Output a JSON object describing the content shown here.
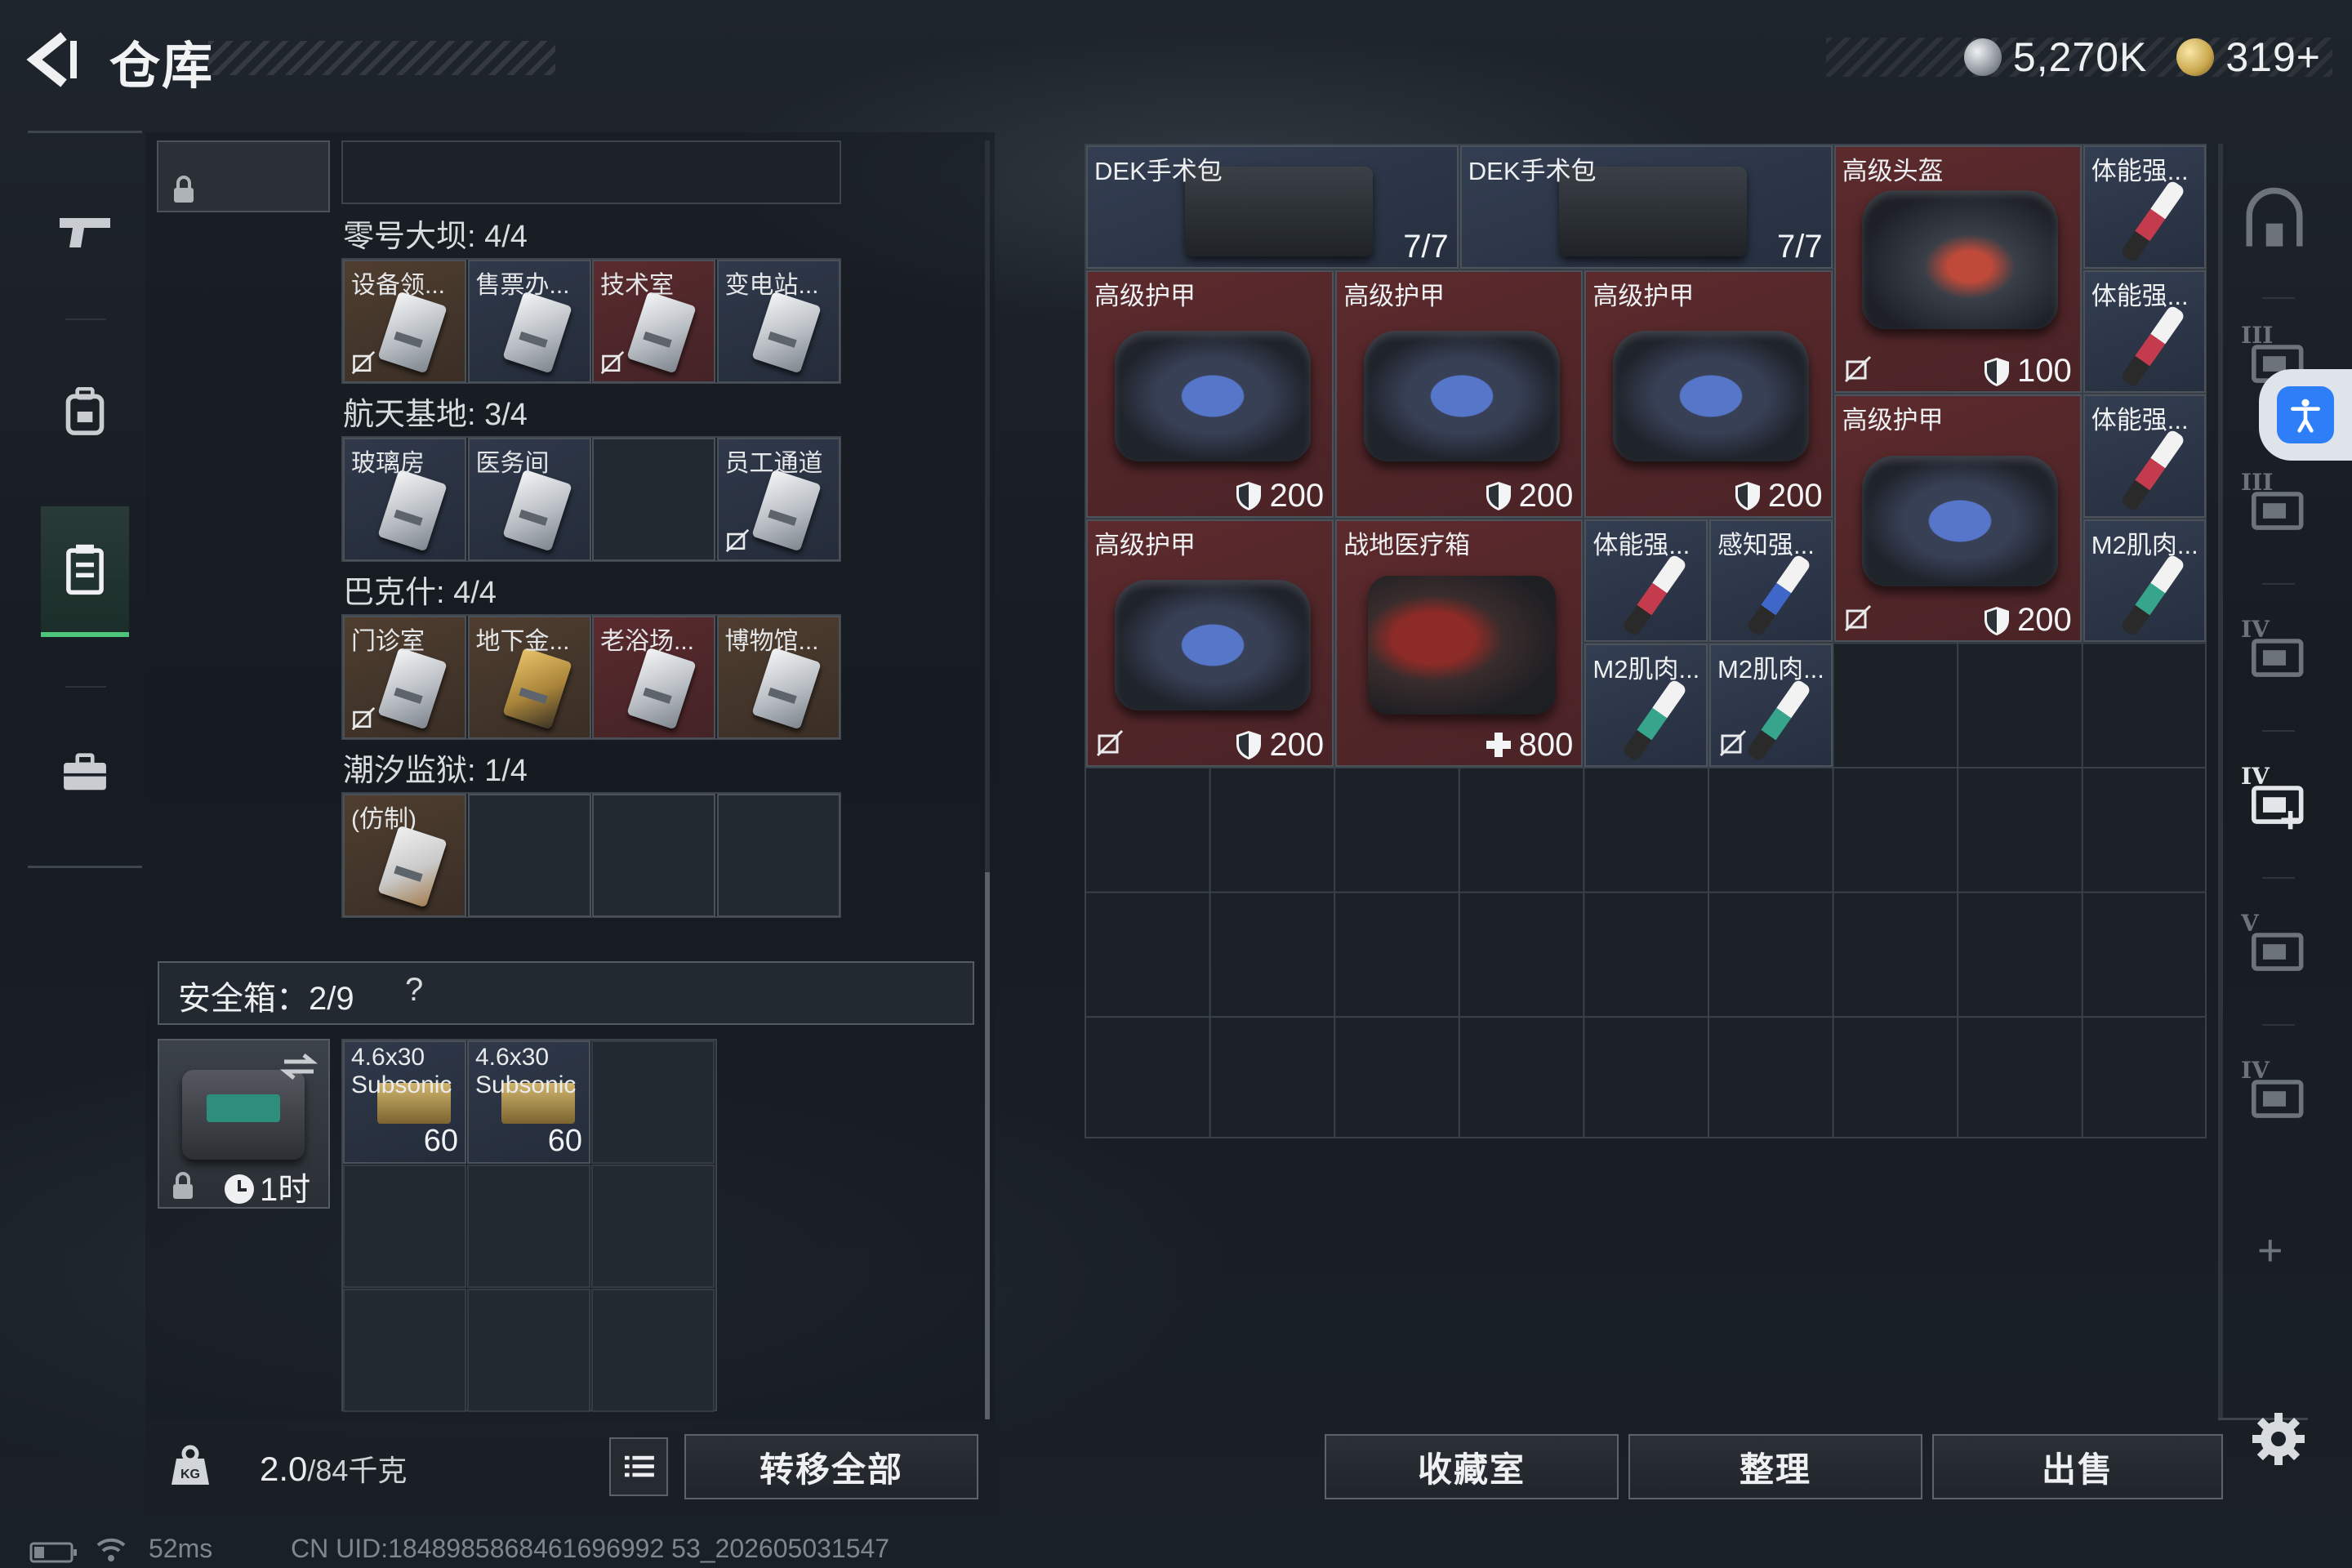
{
  "header": {
    "title": "仓库",
    "currency": [
      {
        "icon": "silver-coin-icon",
        "value": "5,270K"
      },
      {
        "icon": "gold-coin-icon",
        "value": "319+"
      }
    ]
  },
  "left_sidebar": {
    "items": [
      {
        "name": "weapons",
        "icon": "pistol-icon"
      },
      {
        "name": "backpack",
        "icon": "backpack-icon"
      },
      {
        "name": "keys",
        "icon": "keycard-holder-icon",
        "active": true
      },
      {
        "name": "gear",
        "icon": "briefcase-icon"
      }
    ]
  },
  "key_sections": [
    {
      "label": "零号大坝: 4/4",
      "cards": [
        {
          "name": "设备领...",
          "style": "brown",
          "no_drop": true
        },
        {
          "name": "售票办...",
          "style": "blue",
          "no_drop": false
        },
        {
          "name": "技术室",
          "style": "red",
          "no_drop": true
        },
        {
          "name": "变电站...",
          "style": "blue",
          "no_drop": false
        }
      ]
    },
    {
      "label": "航天基地: 3/4",
      "cards": [
        {
          "name": "玻璃房",
          "style": "blue",
          "no_drop": false
        },
        {
          "name": "医务间",
          "style": "blue",
          "no_drop": false
        },
        null,
        {
          "name": "员工通道",
          "style": "blue",
          "no_drop": true
        }
      ]
    },
    {
      "label": "巴克什: 4/4",
      "cards": [
        {
          "name": "门诊室",
          "style": "brown",
          "no_drop": true
        },
        {
          "name": "地下金...",
          "style": "brown",
          "no_drop": false,
          "gold": true
        },
        {
          "name": "老浴场...",
          "style": "red",
          "no_drop": false
        },
        {
          "name": "博物馆...",
          "style": "brown",
          "no_drop": false
        }
      ]
    },
    {
      "label": "潮汐监狱: 1/4",
      "cards": [
        {
          "name": "(仿制)",
          "style": "brown",
          "no_drop": false,
          "fake": true
        },
        null,
        null,
        null
      ]
    }
  ],
  "safe_case": {
    "label": "安全箱：2/9",
    "help": "?",
    "timer": "1时",
    "ammo": [
      {
        "name": "4.6x30\nSubsonic",
        "count": "60"
      },
      {
        "name": "4.6x30\nSubsonic",
        "count": "60"
      }
    ]
  },
  "bottom_left": {
    "weight_current": "2.0",
    "weight_capacity": "/84千克",
    "transfer_all": "转移全部"
  },
  "storage": {
    "items": [
      {
        "name": "DEK手术包",
        "value": "7/7",
        "bg": "blue",
        "icon": "surgical-kit",
        "value_icon": "none"
      },
      {
        "name": "DEK手术包",
        "value": "7/7",
        "bg": "blue",
        "icon": "surgical-kit",
        "value_icon": "none"
      },
      {
        "name": "高级头盔",
        "value": "100",
        "bg": "red",
        "icon": "helmet",
        "value_icon": "shield",
        "no_drop": true
      },
      {
        "name": "体能强...",
        "value": "",
        "bg": "blue",
        "icon": "syringe-red"
      },
      {
        "name": "高级护甲",
        "value": "200",
        "bg": "red",
        "icon": "vest",
        "value_icon": "shield"
      },
      {
        "name": "高级护甲",
        "value": "200",
        "bg": "red",
        "icon": "vest",
        "value_icon": "shield"
      },
      {
        "name": "高级护甲",
        "value": "200",
        "bg": "red",
        "icon": "vest",
        "value_icon": "shield"
      },
      {
        "name": "体能强...",
        "value": "",
        "bg": "blue",
        "icon": "syringe-red"
      },
      {
        "name": "高级护甲",
        "value": "200",
        "bg": "red",
        "icon": "vest",
        "value_icon": "shield",
        "no_drop": true
      },
      {
        "name": "体能强...",
        "value": "",
        "bg": "blue",
        "icon": "syringe-red"
      },
      {
        "name": "高级护甲",
        "value": "200",
        "bg": "red",
        "icon": "vest",
        "value_icon": "shield",
        "no_drop": true
      },
      {
        "name": "战地医疗箱",
        "value": "800",
        "bg": "red",
        "icon": "medbox",
        "value_icon": "plus"
      },
      {
        "name": "体能强...",
        "value": "",
        "bg": "blue",
        "icon": "syringe-red"
      },
      {
        "name": "感知强...",
        "value": "",
        "bg": "blue",
        "icon": "syringe-blue"
      },
      {
        "name": "M2肌肉...",
        "value": "",
        "bg": "blue",
        "icon": "syringe-green"
      },
      {
        "name": "M2肌肉...",
        "value": "",
        "bg": "blue",
        "icon": "syringe-green"
      },
      {
        "name": "M2肌肉...",
        "value": "",
        "bg": "blue",
        "icon": "syringe-green",
        "no_drop": true
      }
    ]
  },
  "bottom_buttons": {
    "collection": "收藏室",
    "sort": "整理",
    "sell": "出售"
  },
  "right_sidebar": {
    "tabs": [
      {
        "icon": "storage-arch-icon",
        "level": ""
      },
      {
        "icon": "storage-tier-icon",
        "level": "III"
      },
      {
        "icon": "storage-tier-icon",
        "level": "III"
      },
      {
        "icon": "storage-tier-icon",
        "level": "IV"
      },
      {
        "icon": "storage-add-icon",
        "level": "IV"
      },
      {
        "icon": "storage-tier-icon",
        "level": "V"
      },
      {
        "icon": "storage-tier-icon",
        "level": "IV"
      }
    ],
    "add": "+"
  },
  "status": {
    "ping": "52ms",
    "uid": "CN UID:1848985868461696992 53_202605031547"
  },
  "colors": {
    "accent_green": "#4ec57b",
    "rarity_red": "#5c2a2d",
    "rarity_blue": "#343e52",
    "rarity_brown": "#4f3e30",
    "accessibility_blue": "#2d7ef7"
  }
}
